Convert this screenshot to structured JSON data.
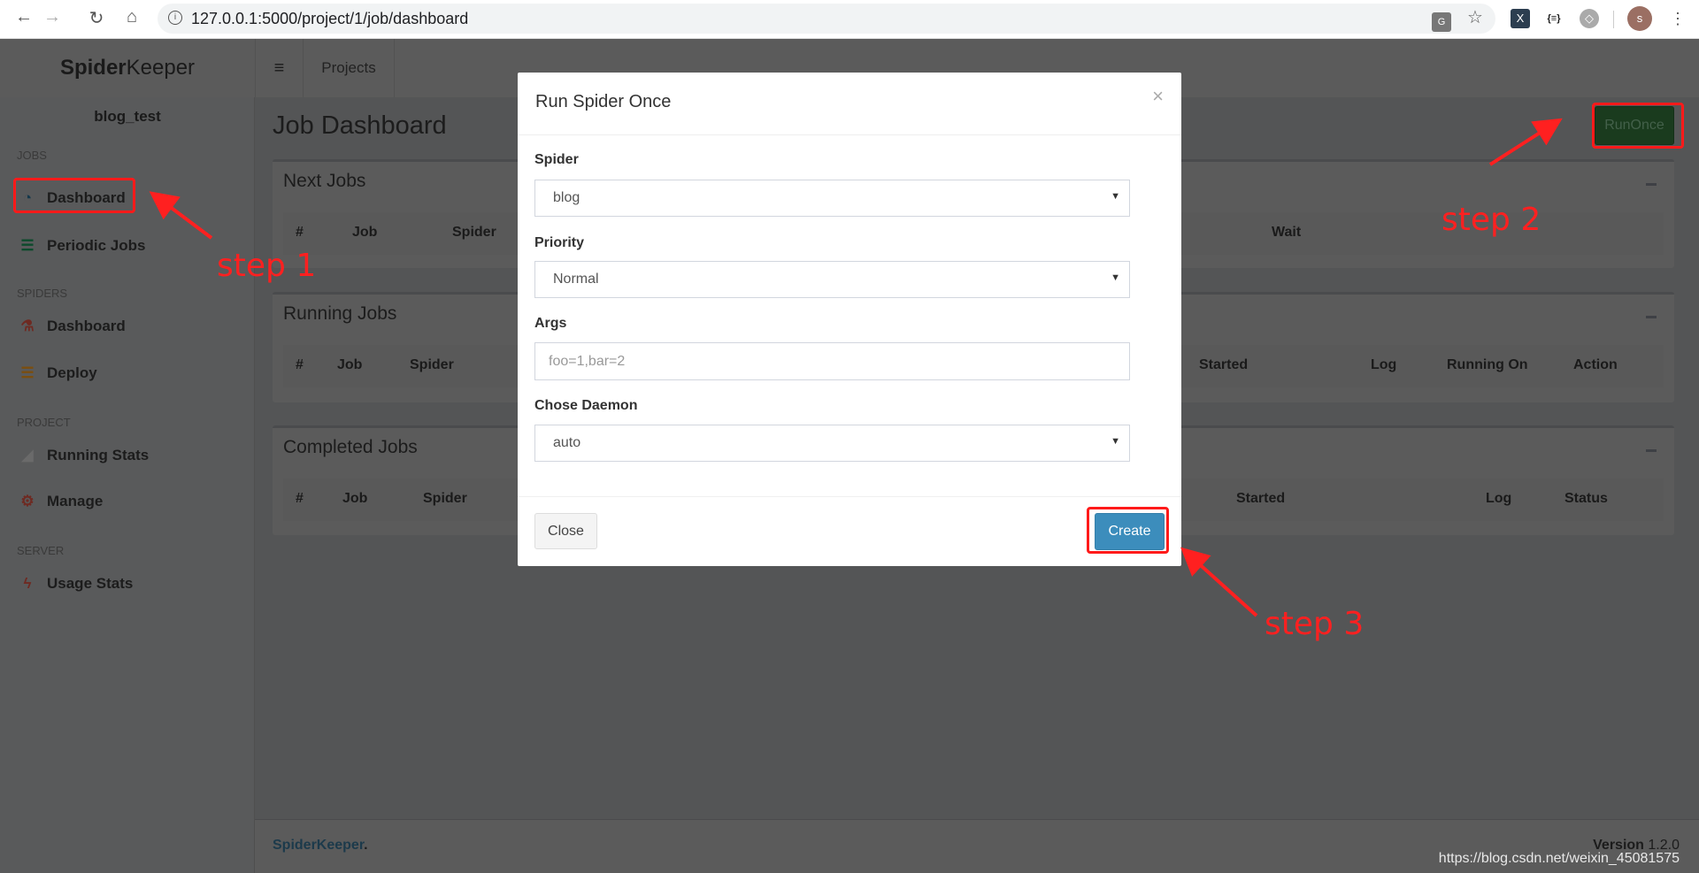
{
  "browser": {
    "url": "127.0.0.1:5000/project/1/job/dashboard",
    "profile_initial": "s"
  },
  "header": {
    "logo_bold": "Spider",
    "logo_rest": "Keeper",
    "projects_label": "Projects"
  },
  "sidebar": {
    "project_name": "blog_test",
    "sections": [
      {
        "title": "JOBS",
        "items": [
          {
            "label": "Dashboard",
            "icon": "dashboard-icon",
            "color": "#3c8dbc"
          },
          {
            "label": "Periodic Jobs",
            "icon": "tasks-icon",
            "color": "#00a65a"
          }
        ]
      },
      {
        "title": "SPIDERS",
        "items": [
          {
            "label": "Dashboard",
            "icon": "flask-icon",
            "color": "#dd4b39"
          },
          {
            "label": "Deploy",
            "icon": "server-icon",
            "color": "#f39c12"
          }
        ]
      },
      {
        "title": "PROJECT",
        "items": [
          {
            "label": "Running Stats",
            "icon": "area-chart-icon",
            "color": "#999999"
          },
          {
            "label": "Manage",
            "icon": "gears-icon",
            "color": "#dd4b39"
          }
        ]
      },
      {
        "title": "SERVER",
        "items": [
          {
            "label": "Usage Stats",
            "icon": "bolt-icon",
            "color": "#dd4b39"
          }
        ]
      }
    ]
  },
  "main": {
    "title": "Job Dashboard",
    "runonce_label": "RunOnce",
    "panels": [
      {
        "title": "Next Jobs",
        "columns": [
          "#",
          "Job",
          "Spider",
          "Wait"
        ]
      },
      {
        "title": "Running Jobs",
        "columns": [
          "#",
          "Job",
          "Spider",
          "Started",
          "Log",
          "Running On",
          "Action"
        ]
      },
      {
        "title": "Completed Jobs",
        "columns": [
          "#",
          "Job",
          "Spider",
          "Started",
          "Log",
          "Status"
        ]
      }
    ]
  },
  "footer": {
    "brand": "SpiderKeeper",
    "brand_dot": ".",
    "version_label": "Version",
    "version": "1.2.0"
  },
  "modal": {
    "title": "Run Spider Once",
    "close_x": "×",
    "spider_label": "Spider",
    "spider_value": "blog",
    "priority_label": "Priority",
    "priority_value": "Normal",
    "args_label": "Args",
    "args_placeholder": "foo=1,bar=2",
    "daemon_label": "Chose Daemon",
    "daemon_value": "auto",
    "close_button": "Close",
    "create_button": "Create"
  },
  "annotations": {
    "step1": "step 1",
    "step2": "step 2",
    "step3": "step 3",
    "color": "#ff2020"
  },
  "watermark": "https://blog.csdn.net/weixin_45081575"
}
